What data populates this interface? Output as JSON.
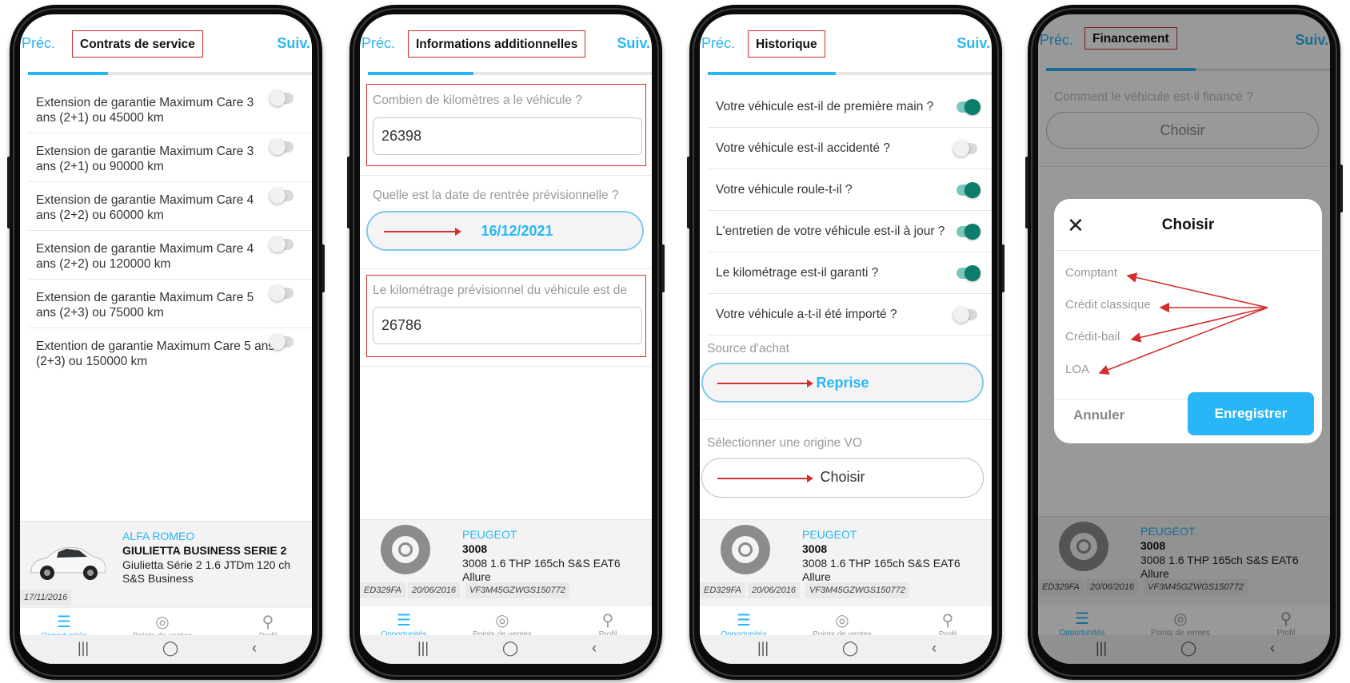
{
  "common": {
    "prev": "Préc.",
    "next": "Suiv.",
    "choose": "Choisir"
  },
  "nav": {
    "opportunities": "Opportunités",
    "points_of_sale": "Points de ventes",
    "profile": "Profil"
  },
  "screen1": {
    "title": "Contrats de service",
    "items": [
      {
        "label": "Extension de garantie Maximum Care 3 ans (2+1) ou 45000 km"
      },
      {
        "label": "Extension de garantie Maximum Care 3 ans (2+1) ou 90000 km"
      },
      {
        "label": "Extension de garantie Maximum Care 4 ans (2+2) ou 60000 km"
      },
      {
        "label": "Extension de garantie Maximum Care 4 ans (2+2) ou 120000 km"
      },
      {
        "label": "Extension de garantie Maximum Care 5 ans (2+3) ou 75000 km"
      },
      {
        "label": "Extention de garantie Maximum Care 5 ans (2+3) ou 150000 km"
      }
    ],
    "car": {
      "brand": "ALFA ROMEO",
      "model": "GIULIETTA BUSINESS SERIE 2",
      "version": "Giulietta Série 2 1.6 JTDm 120 ch S&S Business",
      "date": "17/11/2016"
    }
  },
  "screen2": {
    "title": "Informations additionnelles",
    "q1": "Combien de kilomètres a le véhicule ?",
    "v1": "26398",
    "q2": "Quelle est la date de rentrée prévisionnelle ?",
    "v2": "16/12/2021",
    "q3": "Le kilométrage prévisionnel du véhicule est de",
    "v3": "26786",
    "car": {
      "brand": "PEUGEOT",
      "model": "3008",
      "version": "3008 1.6 THP 165ch S&S EAT6 Allure",
      "plate": "ED329FA",
      "date": "20/06/2016",
      "vin": "VF3M45GZWGS150772"
    }
  },
  "screen3": {
    "title": "Historique",
    "items": [
      {
        "label": "Votre véhicule est-il de première main ?",
        "on": true
      },
      {
        "label": "Votre véhicule est-il accidenté ?",
        "on": false
      },
      {
        "label": "Votre véhicule roule-t-il ?",
        "on": true
      },
      {
        "label": "L'entretien de votre véhicule est-il à jour ?",
        "on": true
      },
      {
        "label": "Le kilométrage est-il garanti ?",
        "on": true
      },
      {
        "label": "Votre véhicule a-t-il été importé ?",
        "on": false
      }
    ],
    "source_label": "Source d'achat",
    "source_value": "Reprise",
    "origin_label": "Sélectionner une origine VO"
  },
  "screen4": {
    "title": "Financement",
    "question": "Comment le véhicule est-il financé ?",
    "modal_title": "Choisir",
    "options": [
      "Comptant",
      "Crédit classique",
      "Crédit-bail",
      "LOA"
    ],
    "cancel": "Annuler",
    "save": "Enregistrer"
  },
  "colors": {
    "accent": "#29b6f6",
    "toggle_on": "#0c7d6b",
    "annotation": "#d32f2f"
  }
}
